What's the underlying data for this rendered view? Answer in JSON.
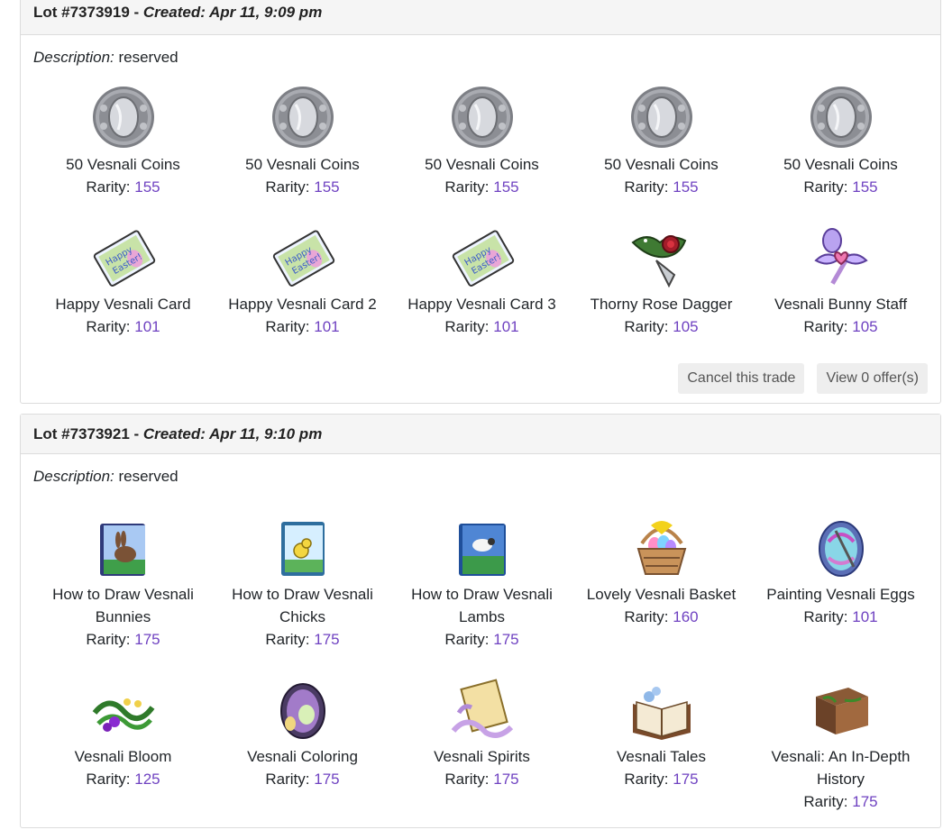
{
  "lots": [
    {
      "lot_label": "Lot #7373919",
      "separator": " - ",
      "created": "Created: Apr 11, 9:09 pm",
      "description_label": "Description:",
      "description_value": " reserved",
      "rarity_label": "Rarity: ",
      "items": [
        {
          "name": "50 Vesnali Coins",
          "rarity": "155",
          "icon": "silver-coin-icon"
        },
        {
          "name": "50 Vesnali Coins",
          "rarity": "155",
          "icon": "silver-coin-icon"
        },
        {
          "name": "50 Vesnali Coins",
          "rarity": "155",
          "icon": "silver-coin-icon"
        },
        {
          "name": "50 Vesnali Coins",
          "rarity": "155",
          "icon": "silver-coin-icon"
        },
        {
          "name": "50 Vesnali Coins",
          "rarity": "155",
          "icon": "silver-coin-icon"
        },
        {
          "name": "Happy Vesnali Card",
          "rarity": "101",
          "icon": "easter-card-icon"
        },
        {
          "name": "Happy Vesnali Card 2",
          "rarity": "101",
          "icon": "easter-card-icon"
        },
        {
          "name": "Happy Vesnali Card 3",
          "rarity": "101",
          "icon": "easter-card-icon"
        },
        {
          "name": "Thorny Rose Dagger",
          "rarity": "105",
          "icon": "rose-dagger-icon"
        },
        {
          "name": "Vesnali Bunny Staff",
          "rarity": "105",
          "icon": "bunny-staff-icon"
        }
      ],
      "buttons": {
        "cancel": "Cancel this trade",
        "offers": "View 0 offer(s)"
      }
    },
    {
      "lot_label": "Lot #7373921",
      "separator": " - ",
      "created": "Created: Apr 11, 9:10 pm",
      "description_label": "Description:",
      "description_value": " reserved",
      "rarity_label": "Rarity: ",
      "items": [
        {
          "name": "How to Draw Vesnali Bunnies",
          "rarity": "175",
          "icon": "bunny-book-icon"
        },
        {
          "name": "How to Draw Vesnali Chicks",
          "rarity": "175",
          "icon": "chick-book-icon"
        },
        {
          "name": "How to Draw Vesnali Lambs",
          "rarity": "175",
          "icon": "lamb-book-icon"
        },
        {
          "name": "Lovely Vesnali Basket",
          "rarity": "160",
          "icon": "egg-basket-icon"
        },
        {
          "name": "Painting Vesnali Eggs",
          "rarity": "101",
          "icon": "painted-egg-icon"
        },
        {
          "name": "Vesnali Bloom",
          "rarity": "125",
          "icon": "flower-vine-icon"
        },
        {
          "name": "Vesnali Coloring",
          "rarity": "175",
          "icon": "coloring-egg-icon"
        },
        {
          "name": "Vesnali Spirits",
          "rarity": "175",
          "icon": "scroll-icon"
        },
        {
          "name": "Vesnali Tales",
          "rarity": "175",
          "icon": "open-book-icon"
        },
        {
          "name": "Vesnali: An In-Depth History",
          "rarity": "175",
          "icon": "history-book-icon"
        }
      ]
    }
  ]
}
